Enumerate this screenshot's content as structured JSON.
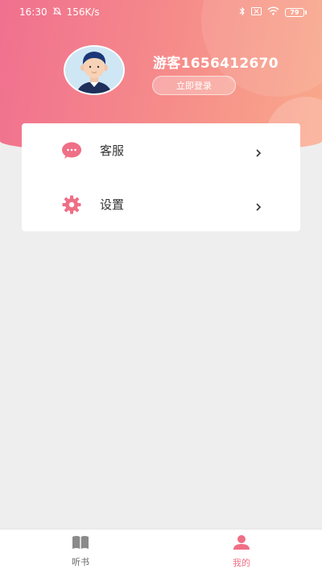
{
  "status_bar": {
    "time": "16:30",
    "net_speed": "156K/s",
    "battery": "79"
  },
  "profile": {
    "username": "游客1656412670",
    "login_button": "立即登录",
    "avatar_icon": "avatar-boy-icon"
  },
  "menu": {
    "items": [
      {
        "label": "客服",
        "icon": "chat-bubble-icon"
      },
      {
        "label": "设置",
        "icon": "gear-icon"
      }
    ]
  },
  "tabbar": {
    "tabs": [
      {
        "label": "听书",
        "icon": "book-icon",
        "active": false
      },
      {
        "label": "我的",
        "icon": "person-icon",
        "active": true
      }
    ]
  },
  "colors": {
    "accent": "#ef6f86",
    "gradient_start": "#f0708f",
    "gradient_end": "#f9a98b",
    "inactive_tab": "#888888"
  }
}
